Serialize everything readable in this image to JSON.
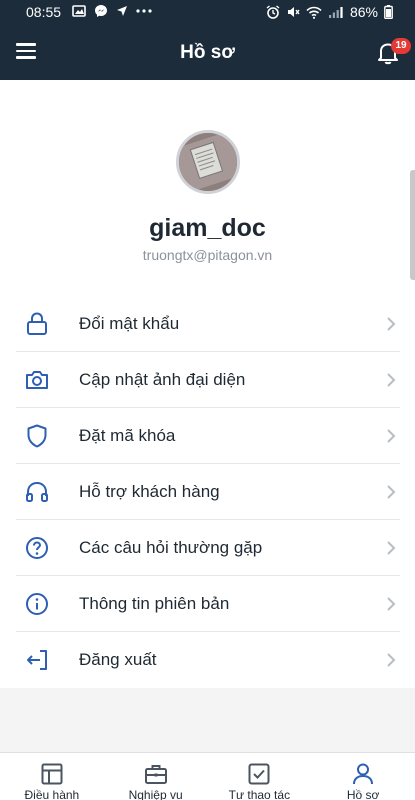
{
  "status_bar": {
    "time": "08:55",
    "left_icons": [
      "gallery-icon",
      "messenger-icon",
      "navigation-icon",
      "more-dots-icon"
    ],
    "right_icons": [
      "alarm-icon",
      "mute-icon",
      "wifi-icon",
      "signal-icon"
    ],
    "battery": "86%"
  },
  "header": {
    "title": "Hồ sơ",
    "notification_count": "19"
  },
  "profile": {
    "username": "giam_doc",
    "email": "truongtx@pitagon.vn"
  },
  "menu": {
    "items": [
      {
        "label": "Đổi mật khẩu",
        "icon": "lock-icon"
      },
      {
        "label": "Cập nhật ảnh đại diện",
        "icon": "camera-icon"
      },
      {
        "label": "Đặt mã khóa",
        "icon": "shield-icon"
      },
      {
        "label": "Hỗ trợ khách hàng",
        "icon": "headphones-icon"
      },
      {
        "label": "Các câu hỏi thường gặp",
        "icon": "help-circle-icon"
      },
      {
        "label": "Thông tin phiên bản",
        "icon": "info-icon"
      },
      {
        "label": "Đăng xuất",
        "icon": "logout-icon"
      }
    ]
  },
  "bottom_nav": {
    "tabs": [
      {
        "label": "Điều hành",
        "icon": "dashboard-icon"
      },
      {
        "label": "Nghiệp vụ",
        "icon": "briefcase-icon"
      },
      {
        "label": "Tự thao tác",
        "icon": "checkbox-icon"
      },
      {
        "label": "Hồ sơ",
        "icon": "user-icon",
        "active": true
      }
    ]
  },
  "colors": {
    "header_bg": "#1c2c3b",
    "icon_blue": "#2f5fb3",
    "badge": "#e53935"
  }
}
